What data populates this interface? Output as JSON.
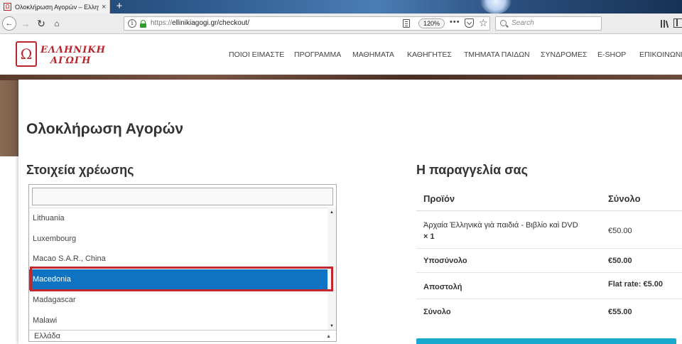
{
  "browser": {
    "tab_title": "Ολοκλήρωση Αγορών – Ελληνι",
    "tab_close": "×",
    "new_tab": "+",
    "url_protocol": "https://",
    "url_rest": "ellinikiagogi.gr/checkout/",
    "zoom": "120%",
    "more": "•••",
    "search_placeholder": "Search"
  },
  "site": {
    "logo_line1": "ΕΛΛΗΝΙΚΗ",
    "logo_line2": "ΑΓΩΓΗ",
    "logo_emblem": "Ω",
    "nav": [
      "ΠΟΙΟΙ ΕΙΜΑΣΤΕ",
      "ΠΡΟΓΡΑΜΜΑ",
      "ΜΑΘΗΜΑΤΑ",
      "ΚΑΘΗΓΗΤΕΣ",
      "ΤΜΗΜΑΤΑ ΠΑΙΔΩΝ",
      "ΣΥΝΔΡΟΜΕΣ",
      "E-SHOP",
      "ΕΠΙΚΟΙΝΩΝΙΑ"
    ]
  },
  "page": {
    "title": "Ολοκλήρωση Αγορών",
    "billing_title": "Στοιχεία χρέωσης",
    "order_title": "Η παραγγελία σας"
  },
  "country_dropdown": {
    "options": [
      "Lithuania",
      "Luxembourg",
      "Macao S.A.R., China",
      "Macedonia",
      "Madagascar",
      "Malawi"
    ],
    "highlighted": "Macedonia",
    "current_value": "Ελλάδα"
  },
  "order": {
    "header": {
      "product": "Προϊόν",
      "total": "Σύνολο"
    },
    "item": {
      "name": "Ἀρχαία Ἑλληνικὰ γιὰ παιδιά - Βιβλίο καὶ DVD",
      "qty": "× 1",
      "price": "€50.00"
    },
    "subtotal": {
      "label": "Υποσύνολο",
      "value": "€50.00"
    },
    "shipping": {
      "label": "Αποστολή",
      "value": "Flat rate: €5.00"
    },
    "total": {
      "label": "Σύνολο",
      "value": "€55.00"
    }
  },
  "colors": {
    "accent_blue": "#0f73c3",
    "highlight_red": "#c1272d",
    "brand_red": "#b8252c",
    "button_cyan": "#19a9cf"
  }
}
